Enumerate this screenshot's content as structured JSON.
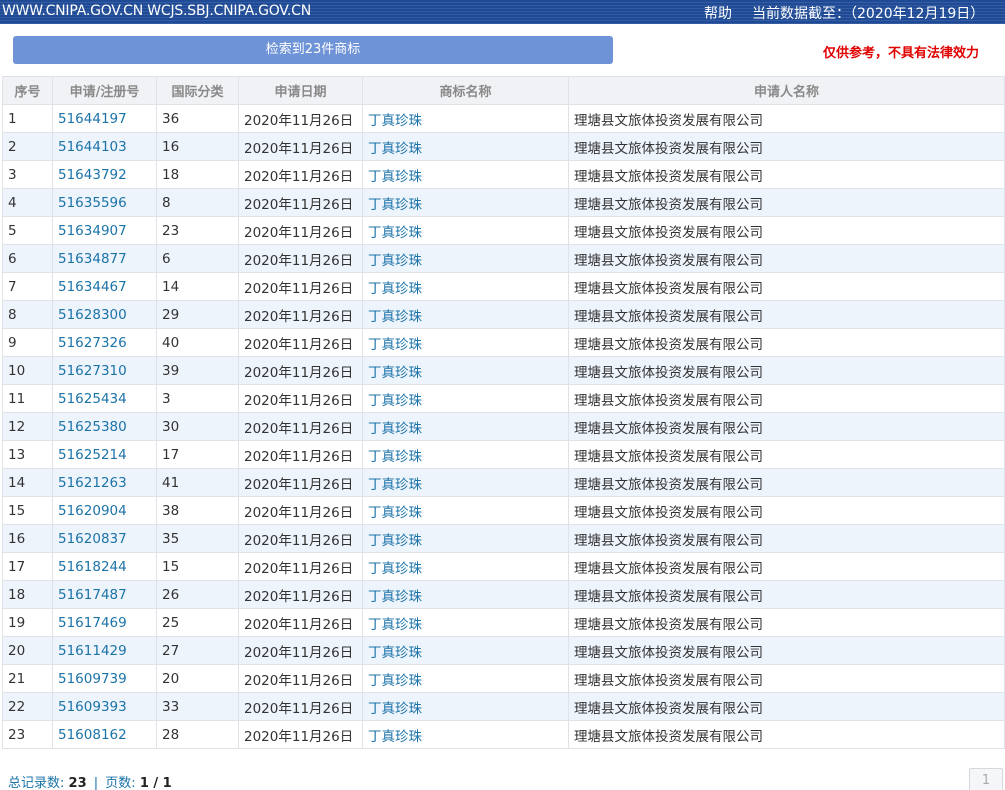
{
  "header": {
    "site_links": "WWW.CNIPA.GOV.CN WCJS.SBJ.CNIPA.GOV.CN",
    "help_label": "帮助",
    "data_as_of": "当前数据截至：（2020年12月19日）"
  },
  "summary": {
    "button_label": "检索到23件商标",
    "disclaimer": "仅供参考，不具有法律效力"
  },
  "table": {
    "headers": [
      "序号",
      "申请/注册号",
      "国际分类",
      "申请日期",
      "商标名称",
      "申请人名称"
    ],
    "rows": [
      [
        "1",
        "51644197",
        "36",
        "2020年11月26日",
        "丁真珍珠",
        "理塘县文旅体投资发展有限公司"
      ],
      [
        "2",
        "51644103",
        "16",
        "2020年11月26日",
        "丁真珍珠",
        "理塘县文旅体投资发展有限公司"
      ],
      [
        "3",
        "51643792",
        "18",
        "2020年11月26日",
        "丁真珍珠",
        "理塘县文旅体投资发展有限公司"
      ],
      [
        "4",
        "51635596",
        "8",
        "2020年11月26日",
        "丁真珍珠",
        "理塘县文旅体投资发展有限公司"
      ],
      [
        "5",
        "51634907",
        "23",
        "2020年11月26日",
        "丁真珍珠",
        "理塘县文旅体投资发展有限公司"
      ],
      [
        "6",
        "51634877",
        "6",
        "2020年11月26日",
        "丁真珍珠",
        "理塘县文旅体投资发展有限公司"
      ],
      [
        "7",
        "51634467",
        "14",
        "2020年11月26日",
        "丁真珍珠",
        "理塘县文旅体投资发展有限公司"
      ],
      [
        "8",
        "51628300",
        "29",
        "2020年11月26日",
        "丁真珍珠",
        "理塘县文旅体投资发展有限公司"
      ],
      [
        "9",
        "51627326",
        "40",
        "2020年11月26日",
        "丁真珍珠",
        "理塘县文旅体投资发展有限公司"
      ],
      [
        "10",
        "51627310",
        "39",
        "2020年11月26日",
        "丁真珍珠",
        "理塘县文旅体投资发展有限公司"
      ],
      [
        "11",
        "51625434",
        "3",
        "2020年11月26日",
        "丁真珍珠",
        "理塘县文旅体投资发展有限公司"
      ],
      [
        "12",
        "51625380",
        "30",
        "2020年11月26日",
        "丁真珍珠",
        "理塘县文旅体投资发展有限公司"
      ],
      [
        "13",
        "51625214",
        "17",
        "2020年11月26日",
        "丁真珍珠",
        "理塘县文旅体投资发展有限公司"
      ],
      [
        "14",
        "51621263",
        "41",
        "2020年11月26日",
        "丁真珍珠",
        "理塘县文旅体投资发展有限公司"
      ],
      [
        "15",
        "51620904",
        "38",
        "2020年11月26日",
        "丁真珍珠",
        "理塘县文旅体投资发展有限公司"
      ],
      [
        "16",
        "51620837",
        "35",
        "2020年11月26日",
        "丁真珍珠",
        "理塘县文旅体投资发展有限公司"
      ],
      [
        "17",
        "51618244",
        "15",
        "2020年11月26日",
        "丁真珍珠",
        "理塘县文旅体投资发展有限公司"
      ],
      [
        "18",
        "51617487",
        "26",
        "2020年11月26日",
        "丁真珍珠",
        "理塘县文旅体投资发展有限公司"
      ],
      [
        "19",
        "51617469",
        "25",
        "2020年11月26日",
        "丁真珍珠",
        "理塘县文旅体投资发展有限公司"
      ],
      [
        "20",
        "51611429",
        "27",
        "2020年11月26日",
        "丁真珍珠",
        "理塘县文旅体投资发展有限公司"
      ],
      [
        "21",
        "51609739",
        "20",
        "2020年11月26日",
        "丁真珍珠",
        "理塘县文旅体投资发展有限公司"
      ],
      [
        "22",
        "51609393",
        "33",
        "2020年11月26日",
        "丁真珍珠",
        "理塘县文旅体投资发展有限公司"
      ],
      [
        "23",
        "51608162",
        "28",
        "2020年11月26日",
        "丁真珍珠",
        "理塘县文旅体投资发展有限公司"
      ]
    ]
  },
  "footer": {
    "total_label": "总记录数:",
    "total_value": "23",
    "separator": "|",
    "pages_label": "页数:",
    "pages_value": "1 / 1",
    "page_button": "1"
  },
  "colors": {
    "header_bar": "#1e4a96",
    "summary_button": "#6e93d6",
    "link": "#1b73a8",
    "disclaimer": "#e00000",
    "row_alt": "#eef4fc"
  }
}
